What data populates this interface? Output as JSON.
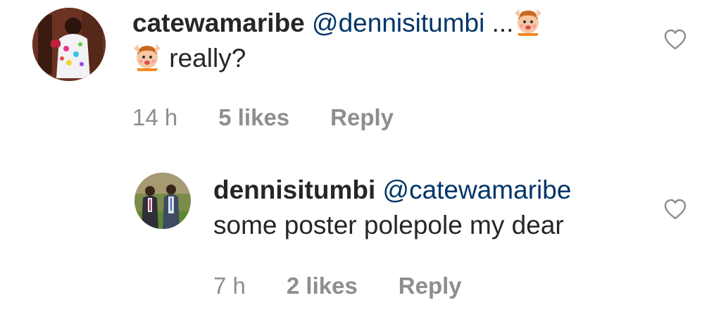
{
  "comments": [
    {
      "username": "catewamaribe",
      "mention": "@dennisitumbi",
      "text_prefix": " ...",
      "text_suffix": " really?",
      "emoji": "raising-hands-face-emoji",
      "time": "14 h",
      "likes": "5 likes",
      "reply_label": "Reply",
      "like_icon": "heart-outline-icon"
    },
    {
      "username": "dennisitumbi",
      "mention": "@catewamaribe",
      "text": " some poster polepole my dear",
      "time": "7 h",
      "likes": "2 likes",
      "reply_label": "Reply",
      "like_icon": "heart-outline-icon"
    }
  ],
  "colors": {
    "username": "#262626",
    "mention": "#003569",
    "meta": "#8e8e8e",
    "background": "#ffffff"
  }
}
